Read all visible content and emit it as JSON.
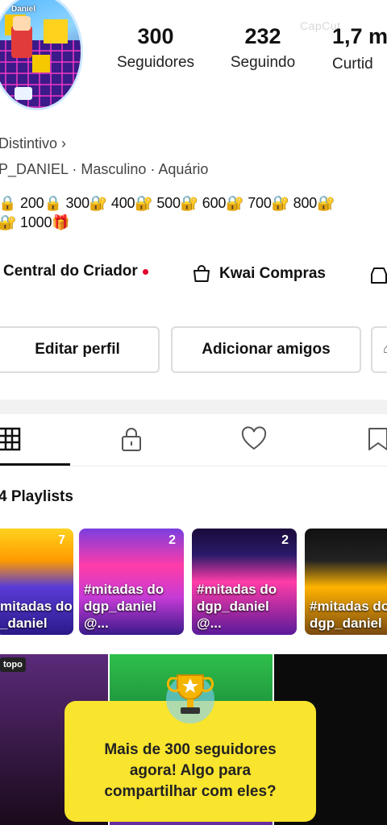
{
  "profile": {
    "avatar_name": "Daniel",
    "badge_link": "Distintivo ›",
    "id_line": "P_DANIEL  ·  Masculino  ·  Aquário",
    "bio_line1": "🔒 200🔒 300🔐 400🔐 500🔐 600🔐 700🔐 800🔐",
    "bio_line2": "🔐 1000🎁"
  },
  "watermark": "CapCut",
  "stats": [
    {
      "num": "300",
      "label": "Seguidores"
    },
    {
      "num": "232",
      "label": "Seguindo"
    },
    {
      "num": "1,7 m",
      "label": "Curtid"
    }
  ],
  "creator": {
    "central_label": "Central do Criador",
    "shop_label": "Kwai Compras"
  },
  "buttons": {
    "edit": "Editar perfil",
    "add_friends": "Adicionar amigos"
  },
  "tabs": [
    "grid-icon",
    "lock-icon",
    "heart-icon",
    "bookmark-icon"
  ],
  "playlists": {
    "title": "4 Playlists",
    "items": [
      {
        "title": "mitadas do\n_daniel",
        "count": "7"
      },
      {
        "title": "#mitadas do\ndgp_daniel @...",
        "count": "2"
      },
      {
        "title": "#mitadas do\ndgp_daniel @...",
        "count": "2"
      },
      {
        "title": "#mitadas do\ndgp_daniel",
        "count": ""
      }
    ]
  },
  "video": {
    "tag": "topo"
  },
  "popup": {
    "message": "Mais de 300 seguidores\nagora! Algo para\ncompartilhar com eles?"
  }
}
